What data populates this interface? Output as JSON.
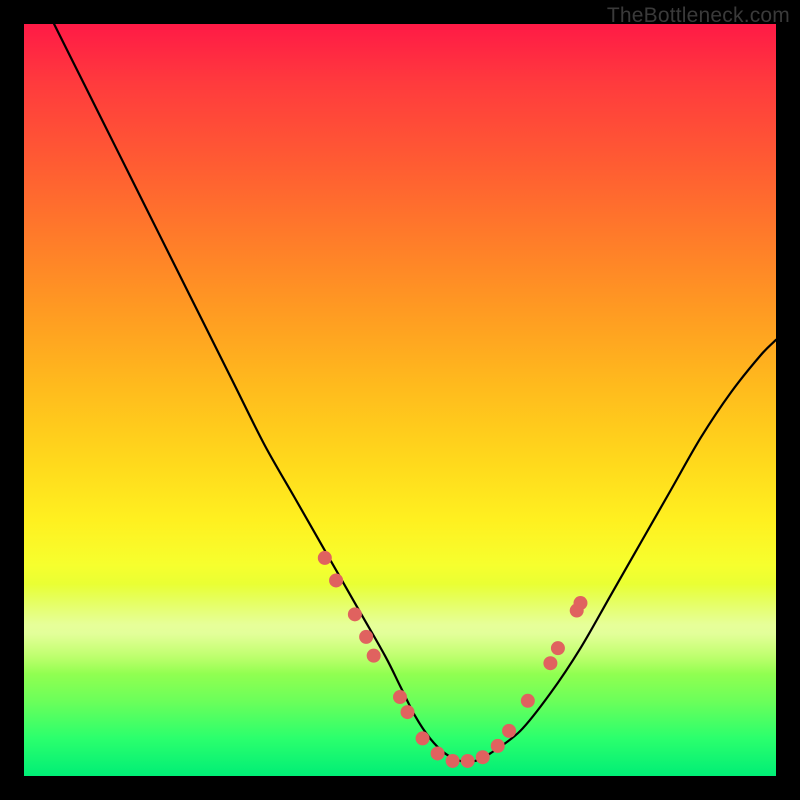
{
  "watermark": "TheBottleneck.com",
  "chart_data": {
    "type": "line",
    "title": "",
    "xlabel": "",
    "ylabel": "",
    "xlim": [
      0,
      100
    ],
    "ylim": [
      0,
      100
    ],
    "grid": false,
    "legend": false,
    "series": [
      {
        "name": "bottleneck-curve",
        "x": [
          4,
          8,
          12,
          16,
          20,
          24,
          28,
          32,
          36,
          40,
          44,
          48,
          50,
          52,
          54,
          56,
          58,
          60,
          62,
          66,
          70,
          74,
          78,
          82,
          86,
          90,
          94,
          98,
          100
        ],
        "y": [
          100,
          92,
          84,
          76,
          68,
          60,
          52,
          44,
          37,
          30,
          23,
          16,
          12,
          8,
          5,
          3,
          2,
          2,
          3,
          6,
          11,
          17,
          24,
          31,
          38,
          45,
          51,
          56,
          58
        ]
      }
    ],
    "markers": {
      "name": "highlight-dots",
      "color": "#e0625f",
      "points": [
        {
          "x": 40.0,
          "y": 29.0
        },
        {
          "x": 41.5,
          "y": 26.0
        },
        {
          "x": 44.0,
          "y": 21.5
        },
        {
          "x": 45.5,
          "y": 18.5
        },
        {
          "x": 46.5,
          "y": 16.0
        },
        {
          "x": 50.0,
          "y": 10.5
        },
        {
          "x": 51.0,
          "y": 8.5
        },
        {
          "x": 53.0,
          "y": 5.0
        },
        {
          "x": 55.0,
          "y": 3.0
        },
        {
          "x": 57.0,
          "y": 2.0
        },
        {
          "x": 59.0,
          "y": 2.0
        },
        {
          "x": 61.0,
          "y": 2.5
        },
        {
          "x": 63.0,
          "y": 4.0
        },
        {
          "x": 64.5,
          "y": 6.0
        },
        {
          "x": 67.0,
          "y": 10.0
        },
        {
          "x": 70.0,
          "y": 15.0
        },
        {
          "x": 71.0,
          "y": 17.0
        },
        {
          "x": 73.5,
          "y": 22.0
        },
        {
          "x": 74.0,
          "y": 23.0
        }
      ]
    },
    "background_gradient": {
      "top_color": "#ff1a46",
      "bottom_color": "#00ee76"
    }
  }
}
